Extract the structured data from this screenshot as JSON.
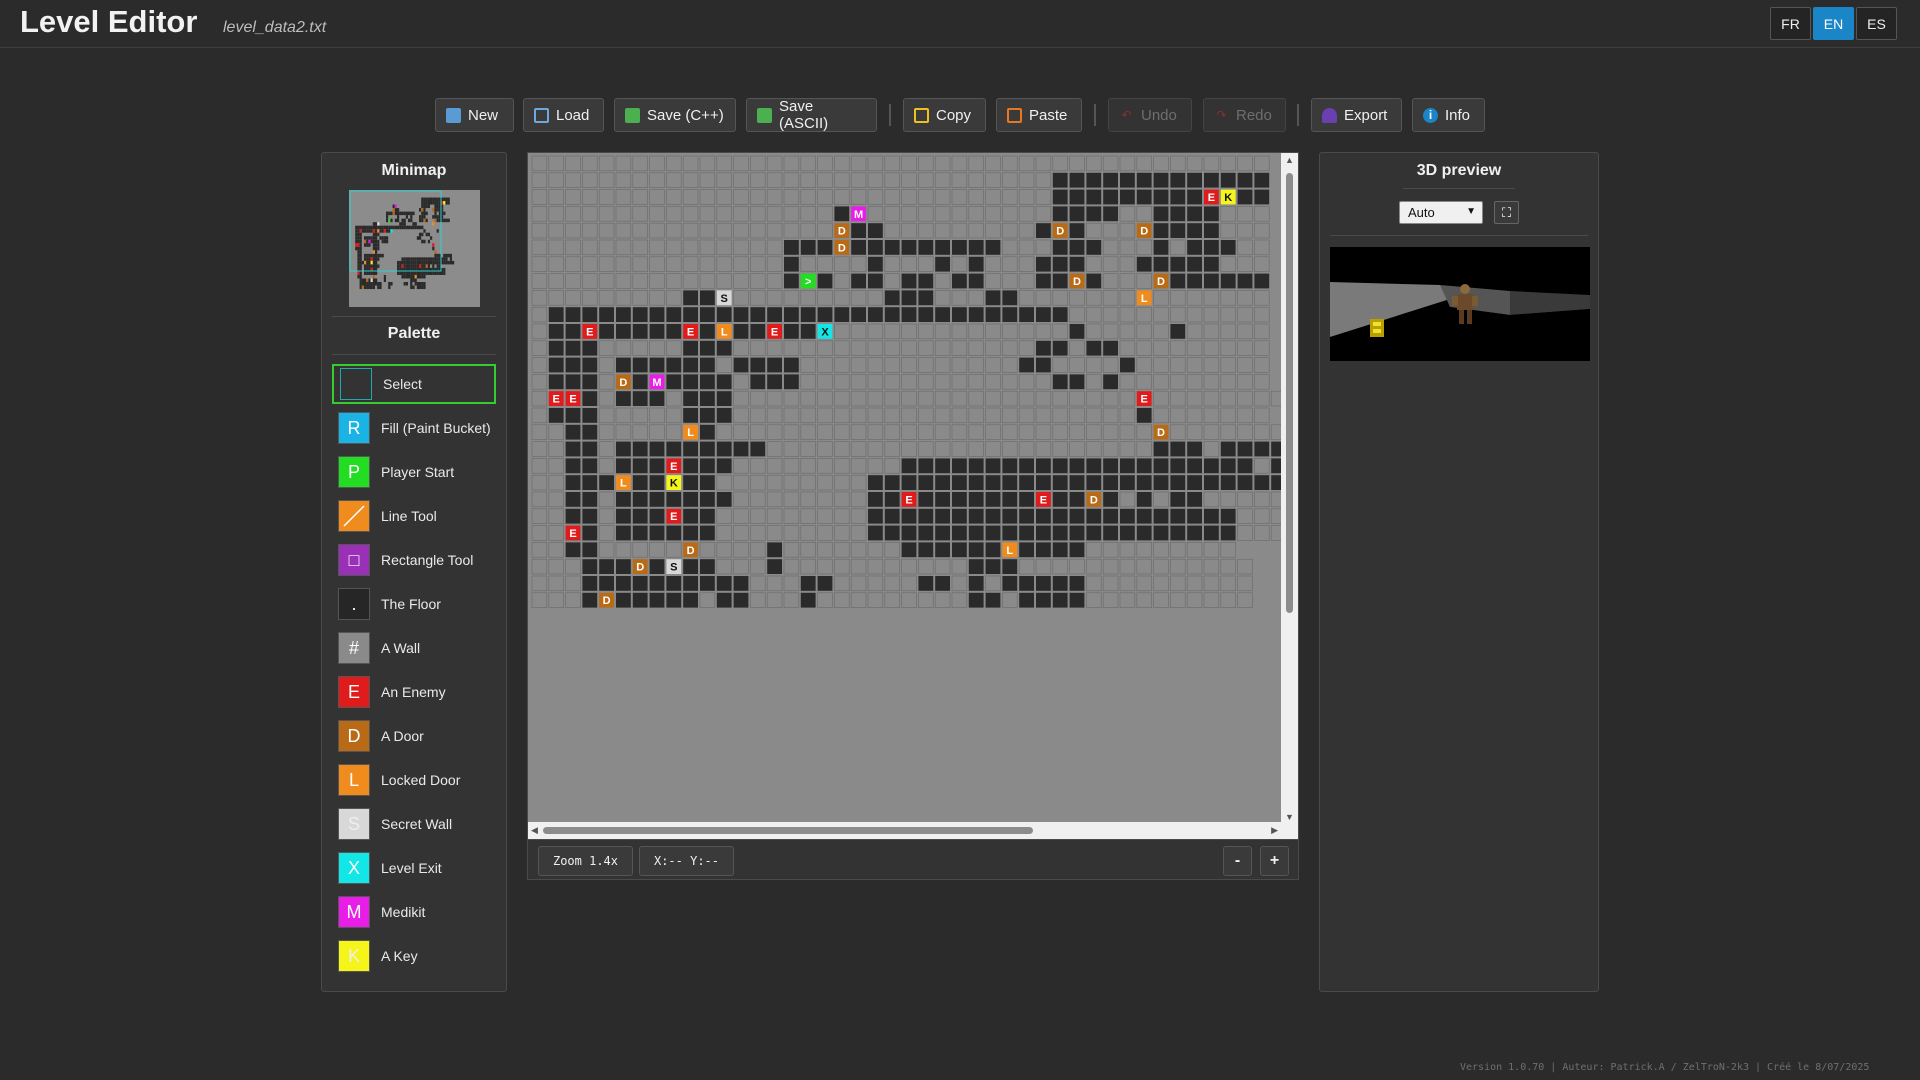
{
  "app": {
    "title": "Level Editor",
    "file": "level_data2.txt"
  },
  "languages": [
    {
      "code": "FR",
      "active": false
    },
    {
      "code": "EN",
      "active": true
    },
    {
      "code": "ES",
      "active": false
    }
  ],
  "toolbar": {
    "new": "New",
    "load": "Load",
    "save_cpp": "Save (C++)",
    "save_ascii": "Save (ASCII)",
    "copy": "Copy",
    "paste": "Paste",
    "undo": "Undo",
    "redo": "Redo",
    "export": "Export",
    "info": "Info"
  },
  "minimap": {
    "title": "Minimap"
  },
  "palette": {
    "title": "Palette",
    "items": [
      {
        "symbol": "",
        "label": "Select",
        "color": "#333333",
        "selected": true
      },
      {
        "symbol": "R",
        "label": "Fill (Paint Bucket)",
        "color": "#1ab3e6"
      },
      {
        "symbol": "P",
        "label": "Player Start",
        "color": "#22dd22"
      },
      {
        "symbol": "",
        "label": "Line Tool",
        "color": "#f08c1e"
      },
      {
        "symbol": "□",
        "label": "Rectangle Tool",
        "color": "#9b30b8"
      },
      {
        "symbol": ".",
        "label": "The Floor",
        "color": "#262626"
      },
      {
        "symbol": "#",
        "label": "A Wall",
        "color": "#8a8a8a"
      },
      {
        "symbol": "E",
        "label": "An Enemy",
        "color": "#e01b1b"
      },
      {
        "symbol": "D",
        "label": "A Door",
        "color": "#b86a16"
      },
      {
        "symbol": "L",
        "label": "Locked Door",
        "color": "#f08c1e"
      },
      {
        "symbol": "S",
        "label": "Secret Wall",
        "color": "#d8d8d8"
      },
      {
        "symbol": "X",
        "label": "Level Exit",
        "color": "#12e6e6"
      },
      {
        "symbol": "M",
        "label": "Medikit",
        "color": "#e81ee8"
      },
      {
        "symbol": "K",
        "label": "A Key",
        "color": "#f5f51a"
      }
    ]
  },
  "map": {
    "colors": {
      "wall": "#8a8a8a",
      "floor": "#2a2a2a",
      "gridline": "#6a6a6a"
    },
    "rows": [
      "############################################",
      "###############################.............",
      "###############################.........EK..",
      "##################.M###########....##....###",
      "##################D..#########.D.###D....###",
      "###############...D.........###...###.#...##",
      "###############.####.###.#.###...###.....###",
      "###############.>.#..#..#..###..D.###D......",
      "#########..S#########...###..#######L#######",
      "#...............................############",
      "#..E.....E.L..E..X##############.#####.#####",
      "#...#####...##################..#..#########",
      "#...#......#....#############..####.########",
      "#...#D.M....#...###############..#.#########",
      "#EE.#...#...########################E########",
      "#...#####...########################.#######",
      "##..#####L.##########################D#######",
      "##..#.........#######################...#....",
      "##..#...E...##########.....................#.",
      "##...L..K..#########..........................",
      "##..#.......########..E.......E..D.#.#..######",
      "##..#...E..#########......................###",
      "##E.#......#########......................###",
      "##..#####D####.#######......L....#########",
      "###...D.S..###.###########...##############",
      "###..........###..#####..#.#.....##########",
      "###.D.....#..###.#########..#....##########"
    ]
  },
  "status": {
    "zoom": "Zoom 1.4x",
    "coords": "X:-- Y:--",
    "zoom_out": "-",
    "zoom_in": "+"
  },
  "preview": {
    "title": "3D preview",
    "mode": "Auto",
    "fullscreen_icon": "fullscreen-icon"
  },
  "footer": "Version 1.0.70 | Auteur: Patrick.A / ZelTroN-2k3 | Créé le 8/07/2025"
}
